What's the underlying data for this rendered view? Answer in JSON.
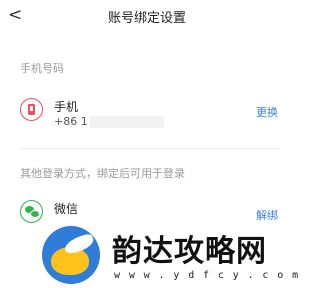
{
  "header": {
    "back_icon": "chevron-left-icon",
    "back_glyph": "<",
    "title": "账号绑定设置"
  },
  "phone_section": {
    "label": "手机号码",
    "item": {
      "icon": "phone-icon",
      "title": "手机",
      "number_prefix": "+86 1",
      "action": "更换"
    }
  },
  "other_section": {
    "label": "其他登录方式，绑定后可用于登录",
    "item": {
      "icon": "wechat-icon",
      "title": "微信",
      "action": "解绑"
    }
  },
  "watermark": {
    "text": "韵达攻略网",
    "url": "w w w . y d f c y . c o m"
  },
  "colors": {
    "accent_link": "#3d83d6",
    "phone_icon": "#e8505b",
    "wechat_icon": "#32b44b"
  }
}
